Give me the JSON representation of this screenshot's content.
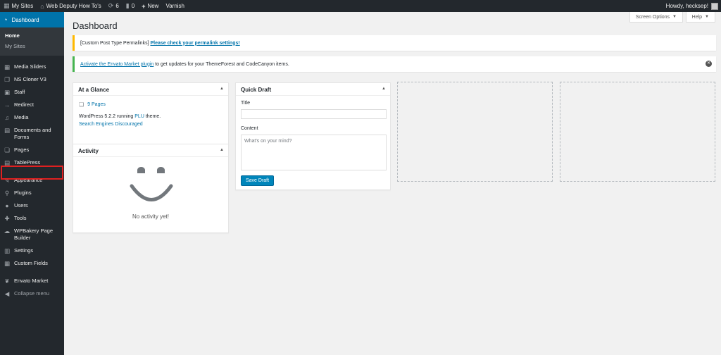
{
  "adminbar": {
    "my_sites": "My Sites",
    "site_name": "Web Deputy How To's",
    "updates_count": "6",
    "comments_count": "0",
    "new_label": "New",
    "varnish_label": "Varnish",
    "howdy": "Howdy, hecksep!"
  },
  "sidebar": {
    "dashboard": "Dashboard",
    "submenu": [
      "Home",
      "My Sites"
    ],
    "items": [
      {
        "label": "Media Sliders",
        "icon": "grid-icon"
      },
      {
        "label": "NS Cloner V3",
        "icon": "copy-icon"
      },
      {
        "label": "Staff",
        "icon": "staff-icon"
      },
      {
        "label": "Redirect",
        "icon": "redirect-icon"
      },
      {
        "label": "Media",
        "icon": "media-icon"
      },
      {
        "label": "Documents and Forms",
        "icon": "documents-icon"
      },
      {
        "label": "Pages",
        "icon": "pages-icon"
      },
      {
        "label": "TablePress",
        "icon": "table-icon"
      },
      {
        "label": "Appearance",
        "icon": "brush-icon"
      },
      {
        "label": "Plugins",
        "icon": "plugin-icon"
      },
      {
        "label": "Users",
        "icon": "users-icon"
      },
      {
        "label": "Tools",
        "icon": "wrench-icon"
      },
      {
        "label": "WPBakery Page Builder",
        "icon": "builder-icon"
      },
      {
        "label": "Settings",
        "icon": "settings-icon"
      },
      {
        "label": "Custom Fields",
        "icon": "fields-icon"
      },
      {
        "label": "Envato Market",
        "icon": "envato-icon"
      }
    ],
    "collapse": "Collapse menu"
  },
  "header": {
    "title": "Dashboard",
    "screen_options": "Screen Options",
    "help": "Help"
  },
  "notices": {
    "permalinks_prefix": "[Custom Post Type Permalinks]",
    "permalinks_link": "Please check your permalink settings!",
    "envato_link": "Activate the Envato Market plugin",
    "envato_suffix": "to get updates for your ThemeForest and CodeCanyon items."
  },
  "at_a_glance": {
    "title": "At a Glance",
    "pages": "9 Pages",
    "wp_text_before": "WordPress 5.2.2 running",
    "theme_link": "PLU",
    "wp_text_after": "theme.",
    "search_engines": "Search Engines Discouraged"
  },
  "activity": {
    "title": "Activity",
    "empty": "No activity yet!"
  },
  "quick_draft": {
    "title": "Quick Draft",
    "title_label": "Title",
    "content_label": "Content",
    "content_placeholder": "What's on your mind?",
    "save_button": "Save Draft"
  },
  "colors": {
    "admin_bar": "#23282d",
    "active_menu": "#0073aa",
    "highlight": "#e02020",
    "button": "#0085ba"
  }
}
